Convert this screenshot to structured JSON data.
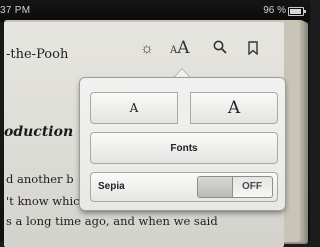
{
  "status_bar": {
    "time": "37 PM",
    "battery_percent": "96 %"
  },
  "book": {
    "title": "-the-Pooh",
    "chapter_heading": "oduction",
    "lines": [
      "d  another  b",
      "'t know which) and that he used to",
      "s a long time ago, and when we said"
    ]
  },
  "toolbar": {
    "icons": [
      "brightness-icon",
      "font-size-icon",
      "search-icon",
      "bookmark-icon"
    ],
    "font_size_small": "A",
    "font_size_big": "A"
  },
  "popover": {
    "smaller_label": "A",
    "larger_label": "A",
    "fonts_label": "Fonts",
    "sepia_label": "Sepia",
    "sepia_state": "OFF"
  }
}
